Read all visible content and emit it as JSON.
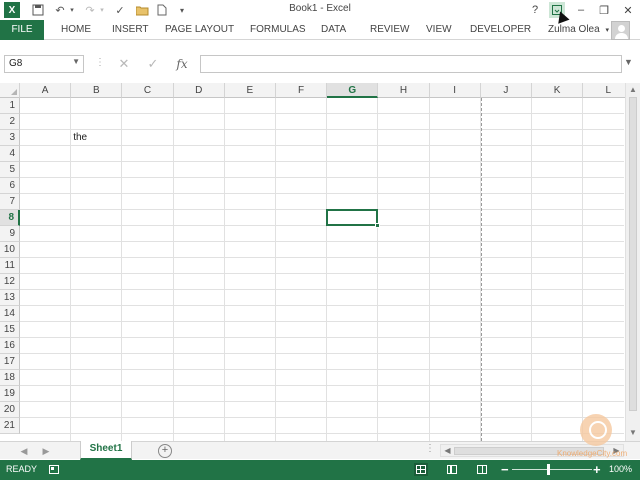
{
  "title": "Book1 - Excel",
  "file_tab": "FILE",
  "tabs": [
    "HOME",
    "INSERT",
    "PAGE LAYOUT",
    "FORMULAS",
    "DATA",
    "REVIEW",
    "VIEW",
    "DEVELOPER"
  ],
  "user_name": "Zulma Olea",
  "quick_access": {
    "excel_icon": "X",
    "help": "?",
    "minimize": "‒",
    "restore": "❐",
    "close": "✕",
    "more": "▾"
  },
  "formula_bar": {
    "name_box": "G8",
    "fx": "fx",
    "value": ""
  },
  "columns": [
    "A",
    "B",
    "C",
    "D",
    "E",
    "F",
    "G",
    "H",
    "I",
    "J",
    "K",
    "L"
  ],
  "rows": [
    "1",
    "2",
    "3",
    "4",
    "5",
    "6",
    "7",
    "8",
    "9",
    "10",
    "11",
    "12",
    "13",
    "14",
    "15",
    "16",
    "17",
    "18",
    "19",
    "20",
    "21"
  ],
  "active_cell": {
    "column": "G",
    "row": "8"
  },
  "cells": {
    "B3": "the"
  },
  "sheets": [
    "Sheet1"
  ],
  "status": "READY",
  "zoom": "100%",
  "watermark": "KnowledgeCity.com",
  "colors": {
    "accent": "#217346",
    "grid": "#e1e1e1",
    "header_bg": "#f3f3f3"
  }
}
